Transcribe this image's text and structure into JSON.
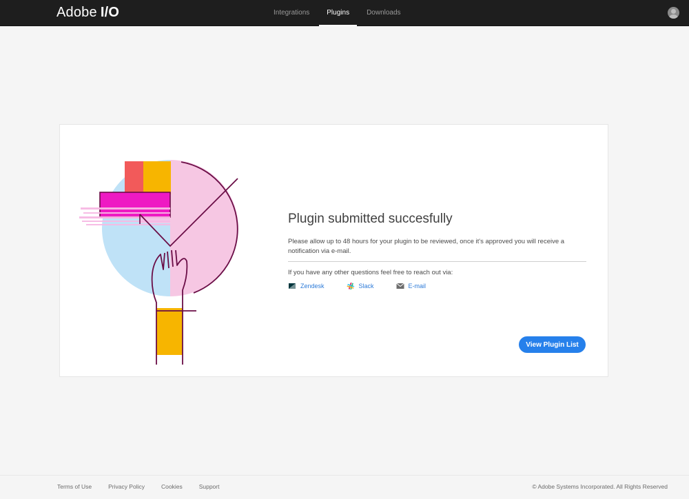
{
  "header": {
    "brand_primary": "Adobe",
    "brand_secondary": "I/O",
    "nav": [
      {
        "label": "Integrations",
        "active": false
      },
      {
        "label": "Plugins",
        "active": true
      },
      {
        "label": "Downloads",
        "active": false
      }
    ],
    "avatar_icon": "user-avatar-icon"
  },
  "card": {
    "title": "Plugin submitted succesfully",
    "description": "Please allow up to 48 hours for your plugin to be reviewed, once it's approved you will receive a notification via e-mail.",
    "questions": "If you have any other questions feel free to reach out via:",
    "contacts": [
      {
        "label": "Zendesk",
        "icon": "zendesk-icon"
      },
      {
        "label": "Slack",
        "icon": "slack-icon"
      },
      {
        "label": "E-mail",
        "icon": "mail-icon"
      }
    ],
    "cta_label": "View Plugin List",
    "illustration_icon": "hand-checkmark-illustration"
  },
  "footer": {
    "links": [
      "Terms of Use",
      "Privacy Policy",
      "Cookies",
      "Support"
    ],
    "copyright": "© Adobe Systems Incorporated. All Rights Reserved"
  },
  "colors": {
    "topbar": "#1e1e1e",
    "accent": "#2680eb",
    "link": "#2d7bd8",
    "page_bg": "#f5f5f5"
  }
}
